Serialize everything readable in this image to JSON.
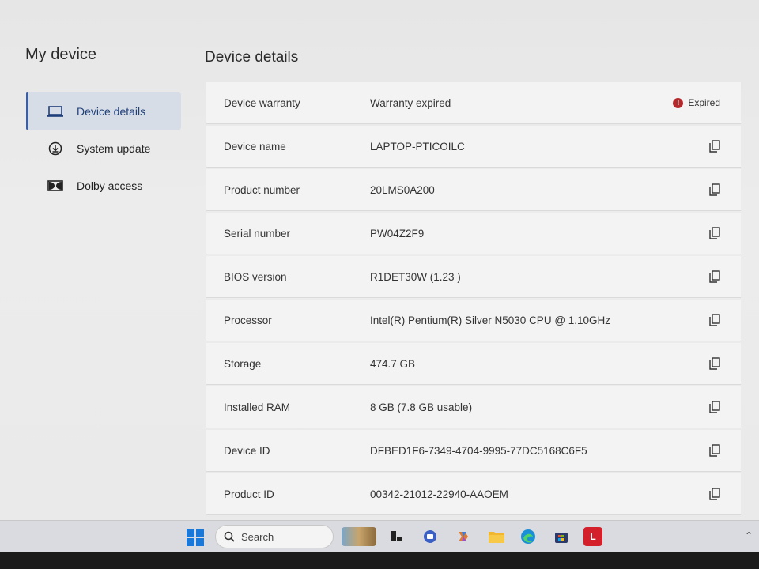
{
  "sidebar": {
    "title": "My device",
    "items": [
      {
        "label": "Device details",
        "icon": "laptop-icon",
        "active": true
      },
      {
        "label": "System update",
        "icon": "download-circle-icon",
        "active": false
      },
      {
        "label": "Dolby access",
        "icon": "dolby-icon",
        "active": false
      }
    ]
  },
  "main": {
    "title": "Device details",
    "rows": [
      {
        "label": "Device warranty",
        "value": "Warranty expired",
        "badge": "Expired"
      },
      {
        "label": "Device name",
        "value": "LAPTOP-PTICOILC"
      },
      {
        "label": "Product number",
        "value": "20LMS0A200"
      },
      {
        "label": "Serial number",
        "value": "PW04Z2F9"
      },
      {
        "label": "BIOS version",
        "value": "R1DET30W (1.23 )"
      },
      {
        "label": "Processor",
        "value": "Intel(R) Pentium(R) Silver N5030 CPU @ 1.10GHz"
      },
      {
        "label": "Storage",
        "value": "474.7 GB"
      },
      {
        "label": "Installed RAM",
        "value": "8 GB (7.8 GB usable)"
      },
      {
        "label": "Device ID",
        "value": "DFBED1F6-7349-4704-9995-77DC5168C6F5"
      },
      {
        "label": "Product ID",
        "value": "00342-21012-22940-AAOEM"
      }
    ]
  },
  "taskbar": {
    "search_label": "Search",
    "lenovo_label": "L"
  },
  "colors": {
    "accent": "#3a5fa8",
    "expired": "#b4282c",
    "windows_blue": "#1a78d8",
    "lenovo_red": "#d4202a"
  }
}
